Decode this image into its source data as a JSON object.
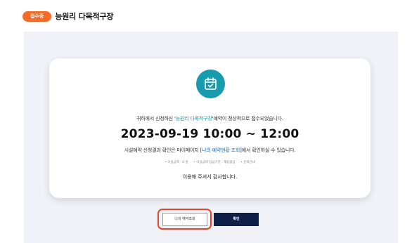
{
  "header": {
    "status_badge": "접수중",
    "title": "능원리 다목적구장"
  },
  "card": {
    "icon": "calendar-check-icon",
    "notice_prefix": "귀하께서 신청하신 '",
    "notice_facility": "능원리 다목적구장",
    "notice_suffix": "'예약이 정상적으로 접수되었습니다.",
    "datetime": "2023-09-19 10:00 ~ 12:00",
    "result_prefix": "시설예약 신청결과 확인은 마이페이지 [",
    "result_link": "나의 예약현황 조회",
    "result_suffix": "]에서 확인하실 수 있습니다.",
    "meta": [
      "• 이용금액 : 0 원",
      "• 이용금액 입금기한 : 해당없음",
      "• 문의안내"
    ],
    "thanks": "이용해 주셔서 감사합니다."
  },
  "buttons": {
    "my_reservation": "나의 예약조회",
    "confirm": "확인"
  },
  "colors": {
    "badge": "#f26b2a",
    "accent_teal": "#179bad",
    "confirm_button": "#0f2048",
    "highlight_ring": "#e8432b"
  }
}
